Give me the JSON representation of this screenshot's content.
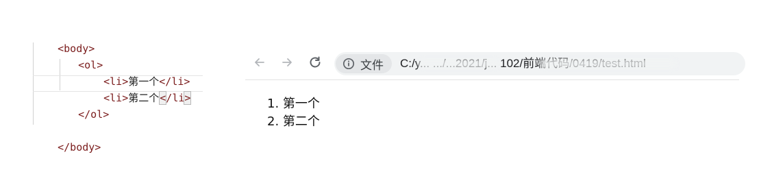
{
  "editor": {
    "lines": {
      "body_open": "<body>",
      "ol_open": "<ol>",
      "li1_open": "<li>",
      "li1_text": "第一个",
      "li1_close": "</li>",
      "li2_open": "<li>",
      "li2_text": "第二个",
      "li2_close_lt": "<",
      "li2_close_rest": "/li",
      "li2_close_gt": ">",
      "ol_close": "</ol>",
      "body_close": "</body>"
    },
    "colors": {
      "tag": "#7a1c1c",
      "guide": "#d0d0d0"
    }
  },
  "browser": {
    "back_icon": "arrow-left-icon",
    "forward_icon": "arrow-right-icon",
    "reload_icon": "reload-icon",
    "info_icon": "info-icon",
    "site_chip_label": "文件",
    "url": "C:/y... .../...2021/j... 102/前端代码/0419/test.html"
  },
  "page": {
    "list_items": [
      "1. 第一个",
      "2. 第二个"
    ]
  }
}
